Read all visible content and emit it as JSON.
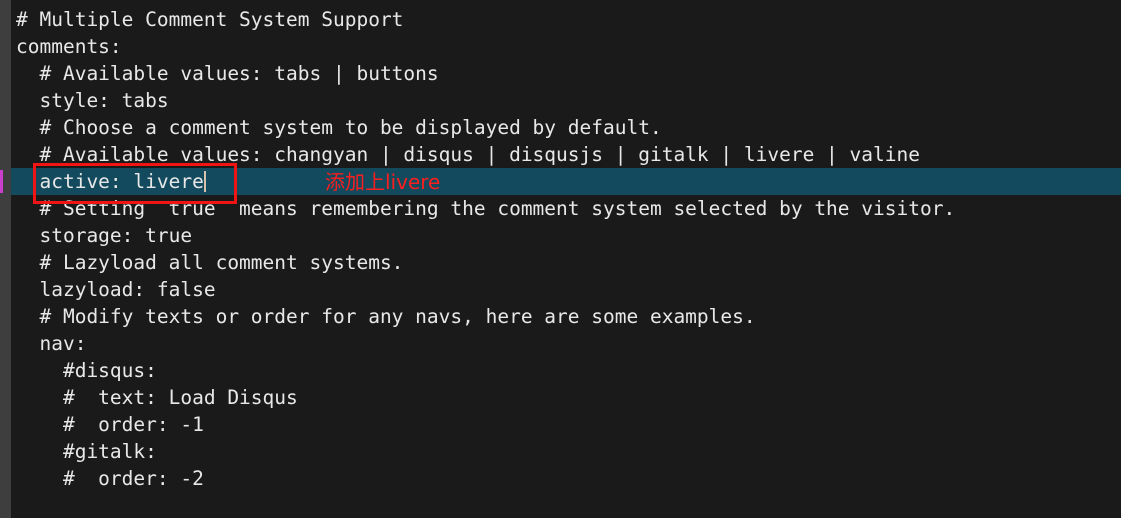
{
  "editor": {
    "background_color": "#1a1a1a",
    "text_color": "#e8e8e8",
    "active_line_color": "#134a5e",
    "gutter_color": "#3e3e3e",
    "active_marker_color": "#cc3fcc",
    "caret_color": "#d8c3ac",
    "lines": [
      {
        "text": "# Multiple Comment System Support",
        "active": false
      },
      {
        "text": "comments:",
        "active": false
      },
      {
        "text": "  # Available values: tabs | buttons",
        "active": false
      },
      {
        "text": "  style: tabs",
        "active": false
      },
      {
        "text": "  # Choose a comment system to be displayed by default.",
        "active": false
      },
      {
        "text": "  # Available values: changyan | disqus | disqusjs | gitalk | livere | valine",
        "active": false
      },
      {
        "text": "  active: livere",
        "active": true
      },
      {
        "text": "  # Setting  true  means remembering the comment system selected by the visitor.",
        "active": false
      },
      {
        "text": "  storage: true",
        "active": false
      },
      {
        "text": "  # Lazyload all comment systems.",
        "active": false
      },
      {
        "text": "  lazyload: false",
        "active": false
      },
      {
        "text": "  # Modify texts or order for any navs, here are some examples.",
        "active": false
      },
      {
        "text": "  nav:",
        "active": false
      },
      {
        "text": "    #disqus:",
        "active": false
      },
      {
        "text": "    #  text: Load Disqus",
        "active": false
      },
      {
        "text": "    #  order: -1",
        "active": false
      },
      {
        "text": "    #gitalk:",
        "active": false
      },
      {
        "text": "    #  order: -2",
        "active": false
      }
    ]
  },
  "annotation": {
    "box_color": "#f01414",
    "text": "添加上livere",
    "text_color": "#fa1e1e"
  }
}
